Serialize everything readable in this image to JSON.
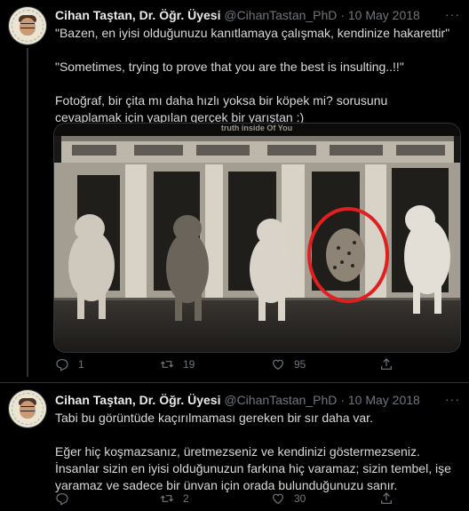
{
  "tweets": [
    {
      "author": "Cihan Taştan, Dr. Öğr. Üyesi",
      "handle": "@CihanTastan_PhD",
      "sep": "·",
      "date": "10 May 2018",
      "more": "···",
      "paragraphs": [
        "\"Bazen, en iyisi olduğunuzu kanıtlamaya çalışmak, kendinize hakarettir\"",
        "\"Sometimes, trying to prove that you are the best is insulting..!!\"",
        "Fotoğraf, bir çita mı daha hızlı yoksa bir köpek mi? sorusunu cevaplamak için yapılan gerçek bir yarıştan :)"
      ],
      "image_watermark": "truth inside Of You",
      "actions": {
        "reply_icon": "reply-icon",
        "reply_count": "1",
        "retweet_icon": "retweet-icon",
        "retweet_count": "19",
        "like_icon": "heart-icon",
        "like_count": "95",
        "share_icon": "share-icon"
      }
    },
    {
      "author": "Cihan Taştan, Dr. Öğr. Üyesi",
      "handle": "@CihanTastan_PhD",
      "sep": "·",
      "date": "10 May 2018",
      "more": "···",
      "paragraphs": [
        "Tabi bu görüntüde kaçırılmaması gereken bir sır daha var.",
        "Eğer hiç koşmazsanız, üretmezseniz ve kendinizi göstermezseniz. İnsanlar sizin en iyisi olduğunuzun farkına hiç varamaz; sizin tembel, işe yaramaz ve sadece bir ünvan için orada bulunduğunuzu sanır."
      ],
      "actions": {
        "reply_icon": "reply-icon",
        "reply_count": "",
        "retweet_icon": "retweet-icon",
        "retweet_count": "2",
        "like_icon": "heart-icon",
        "like_count": "30",
        "share_icon": "share-icon"
      }
    }
  ],
  "colors": {
    "background": "#000000",
    "text": "#d9d9d9",
    "muted": "#6e767d",
    "divider": "#2f3336",
    "highlight_circle": "#e02020"
  }
}
